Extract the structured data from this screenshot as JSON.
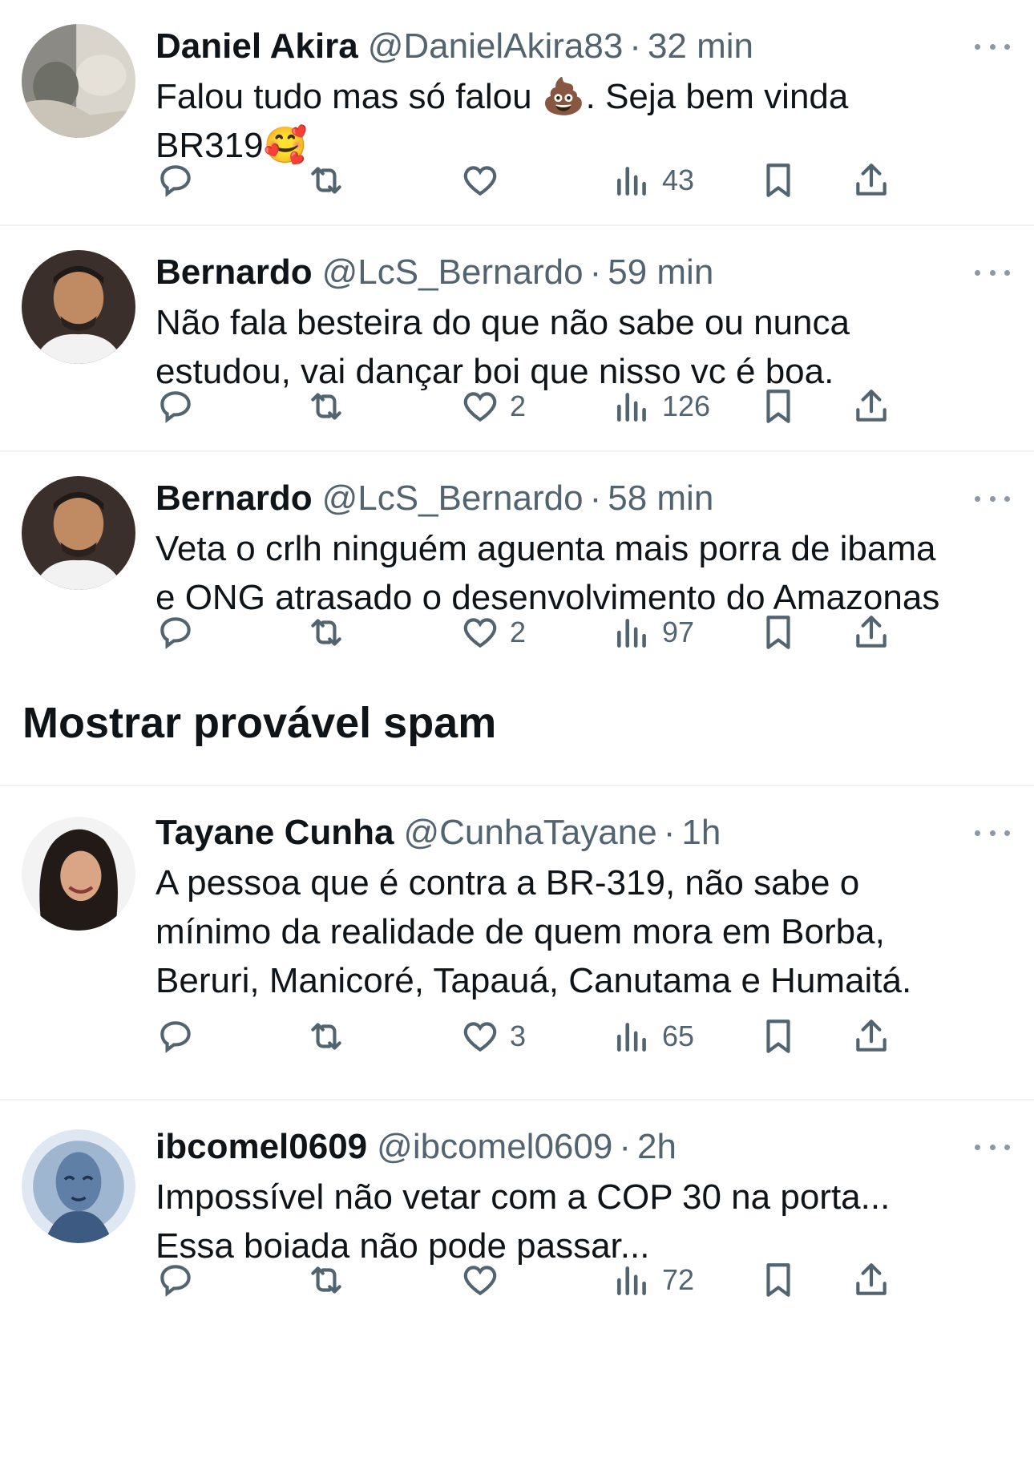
{
  "replies": [
    {
      "name": "Daniel Akira",
      "handle": "@DanielAkira83",
      "time": "32 min",
      "text_html": "Falou tudo mas só falou 💩. Seja bem vinda BR319🥰",
      "line1": "Falou tudo mas só falou 💩. Seja bem vinda",
      "line2": "BR319🥰",
      "likes": "",
      "views": "43",
      "avatar": "cat-photo"
    },
    {
      "name": "Bernardo",
      "handle": "@LcS_Bernardo",
      "time": "59 min",
      "line1": "Não fala besteira do que não sabe ou nunca",
      "line2": "estudou, vai dançar boi que nisso vc é boa.",
      "likes": "2",
      "views": "126",
      "avatar": "man-photo"
    },
    {
      "name": "Bernardo",
      "handle": "@LcS_Bernardo",
      "time": "58 min",
      "line1": "Veta o crlh ninguém aguenta mais porra de ibama",
      "line2": "e ONG atrasado o desenvolvimento do Amazonas",
      "likes": "2",
      "views": "97",
      "avatar": "man-photo"
    }
  ],
  "spam_section": {
    "label": "Mostrar provável spam"
  },
  "spam_replies": [
    {
      "name": "Tayane Cunha",
      "handle": "@CunhaTayane",
      "time": "1h",
      "line1": "A pessoa que é contra a BR-319, não sabe o",
      "line2": "mínimo da realidade de quem mora em Borba,",
      "line3": "Beruri, Manicoré, Tapauá, Canutama e Humaitá.",
      "likes": "3",
      "views": "65",
      "avatar": "woman-photo"
    },
    {
      "name": "ibcomel0609",
      "handle": "@ibcomel0609",
      "time": "2h",
      "line1": "Impossível não vetar com a COP 30 na porta...",
      "line2": "Essa boiada não pode passar...",
      "likes": "",
      "views": "72",
      "avatar": "buddha-art"
    }
  ],
  "separator": "·",
  "icons": [
    "reply-icon",
    "retweet-icon",
    "like-icon",
    "views-icon",
    "bookmark-icon",
    "share-icon",
    "more-icon"
  ]
}
